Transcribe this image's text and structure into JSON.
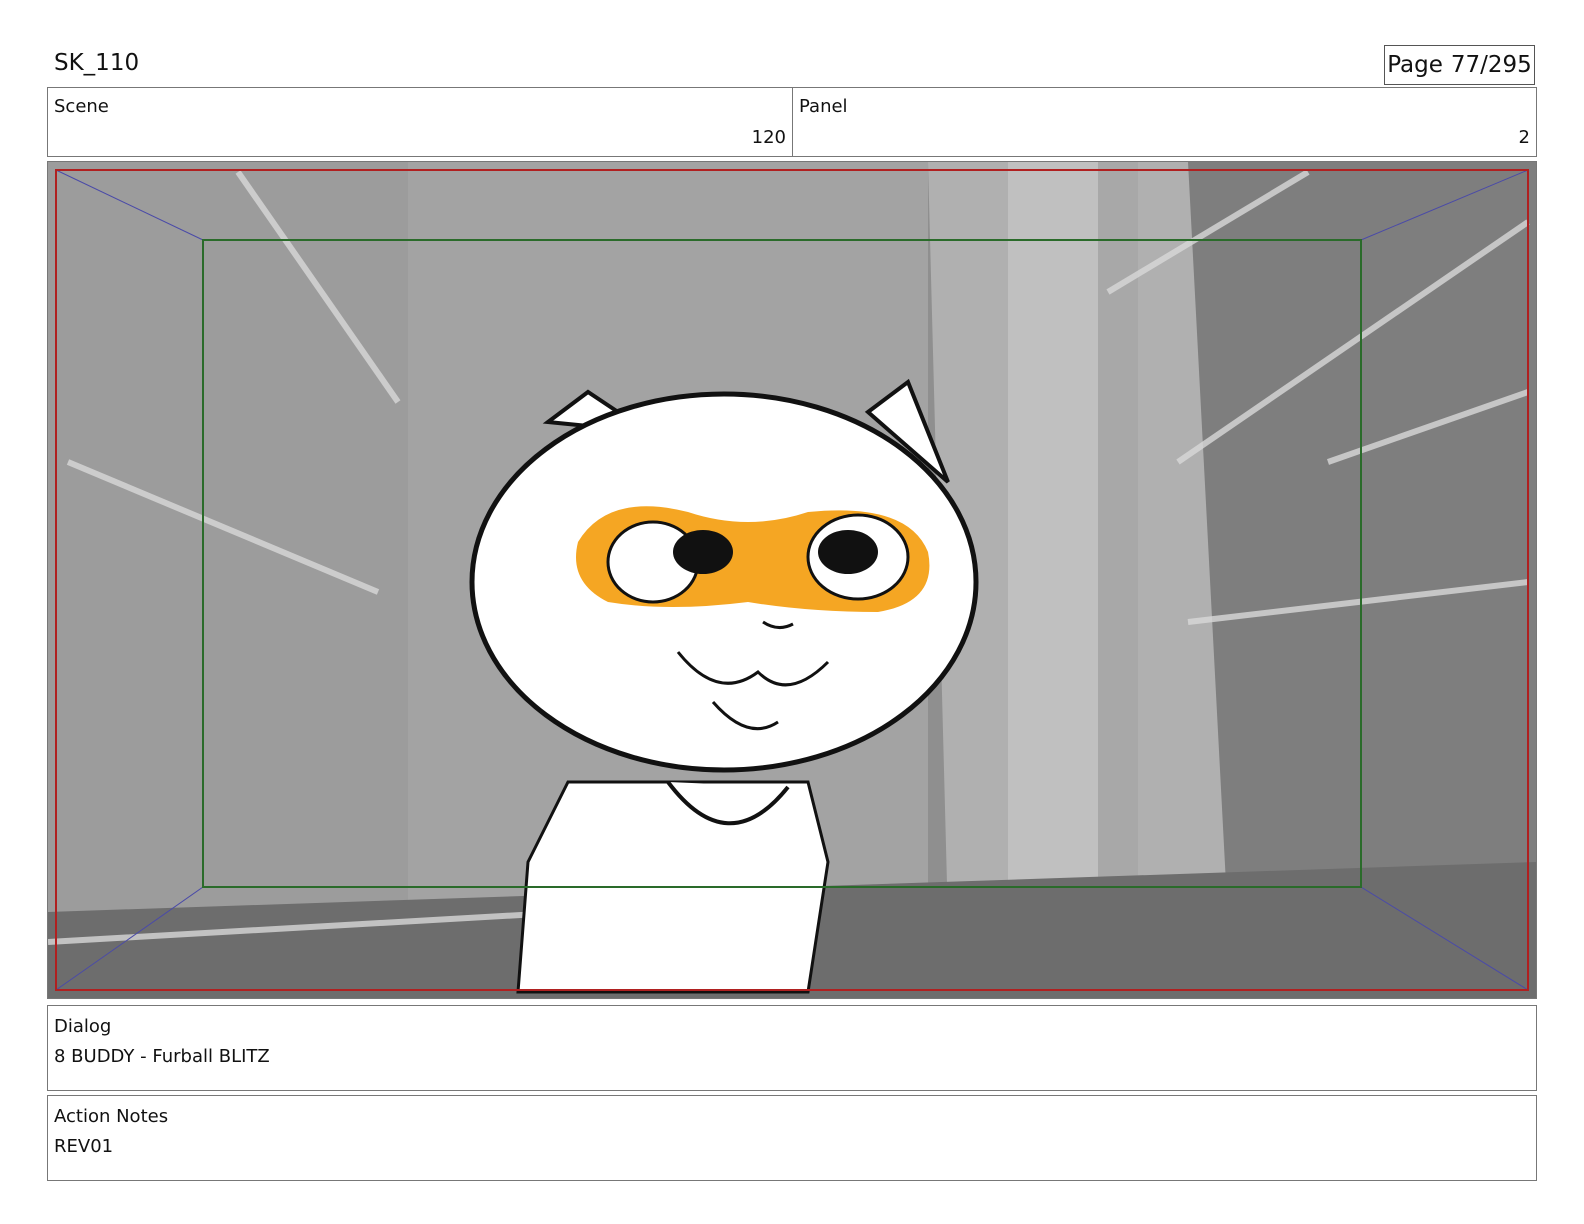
{
  "header": {
    "project_code": "SK_110",
    "page_label": "Page",
    "page_number": "77/295"
  },
  "scene": {
    "label": "Scene",
    "value": "120"
  },
  "panel": {
    "label": "Panel",
    "value": "2"
  },
  "dialog": {
    "label": "Dialog",
    "text": "8 BUDDY - Furball BLITZ"
  },
  "action_notes": {
    "label": "Action Notes",
    "text": "REV01"
  },
  "colors": {
    "safe_frame": "#b02020",
    "title_safe": "#2a6b2a",
    "mask_orange": "#f5a623",
    "perspective_lines": "#4a4aa8"
  }
}
